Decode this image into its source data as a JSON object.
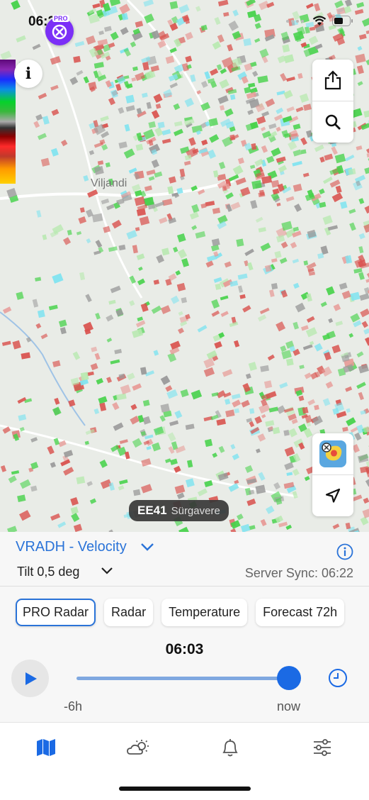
{
  "status_bar": {
    "time": "06:22"
  },
  "app_logo": {
    "badge": "PRO"
  },
  "map": {
    "place_label": "Viljandi",
    "station": {
      "code": "EE41",
      "name": "Sürgavere"
    }
  },
  "product": {
    "title": "VRADH - Velocity",
    "tilt": "Tilt 0,5 deg",
    "server_sync": "Server Sync: 06:22"
  },
  "chips": [
    {
      "label": "PRO Radar",
      "active": true
    },
    {
      "label": "Radar"
    },
    {
      "label": "Temperature"
    },
    {
      "label": "Forecast 72h"
    }
  ],
  "timeline": {
    "current_time": "06:03",
    "start_label": "-6h",
    "end_label": "now",
    "position": 1.0
  },
  "tabs": [
    {
      "name": "map-icon",
      "active": true
    },
    {
      "name": "weather-icon"
    },
    {
      "name": "bell-icon"
    },
    {
      "name": "settings-sliders-icon"
    }
  ],
  "colors": {
    "accent": "#2a73d8",
    "velocity_green": "#46d24a",
    "velocity_red": "#d9534f",
    "velocity_cyan": "#7fe3f0"
  }
}
